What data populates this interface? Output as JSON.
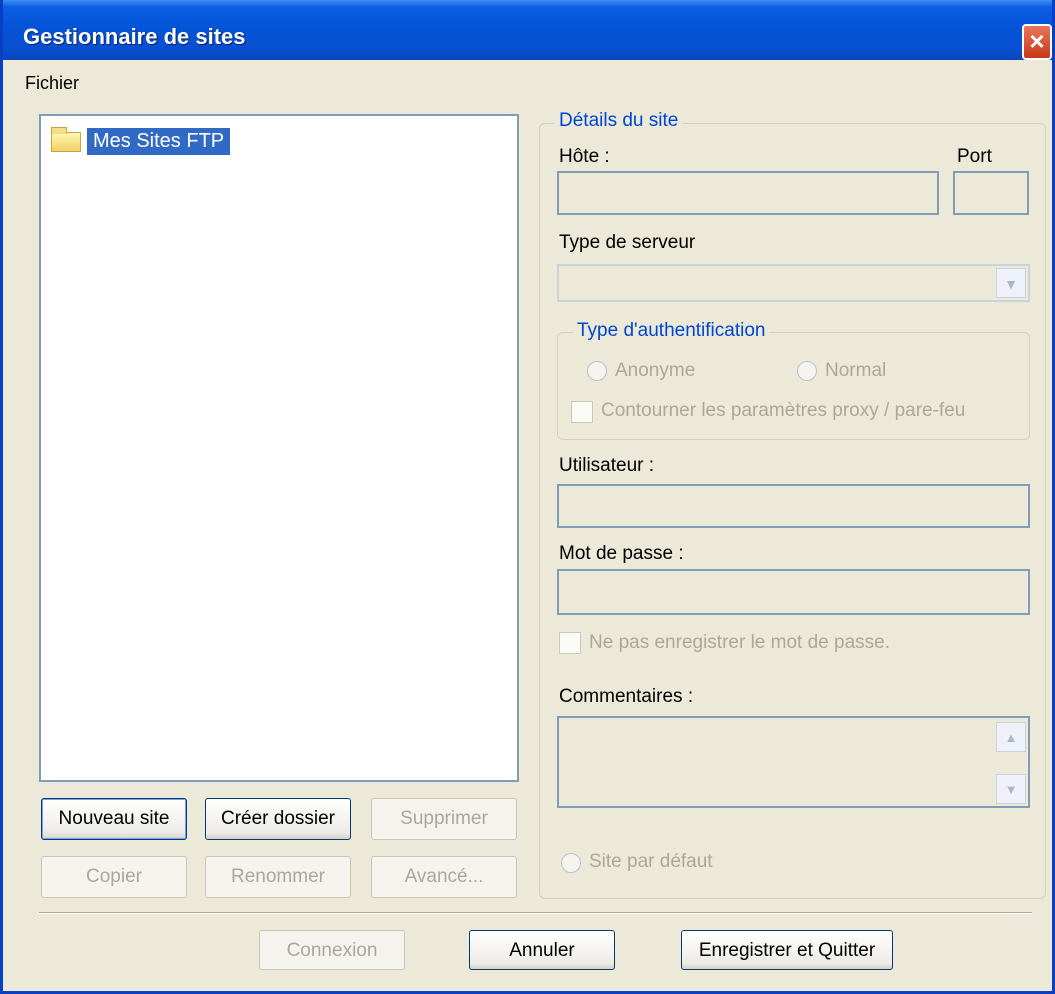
{
  "window": {
    "title": "Gestionnaire de sites",
    "close_icon": "×"
  },
  "menu": {
    "items": [
      {
        "label": "Fichier"
      }
    ]
  },
  "tree": {
    "root_label": "Mes Sites FTP"
  },
  "left_buttons": {
    "new_site": "Nouveau site",
    "new_folder": "Créer dossier",
    "delete": "Supprimer",
    "copy": "Copier",
    "rename": "Renommer",
    "advanced": "Avancé..."
  },
  "details": {
    "legend": "Détails du site",
    "host_label": "Hôte :",
    "host_value": "",
    "port_label": "Port",
    "port_value": "",
    "server_type_label": "Type de serveur",
    "server_type_value": "",
    "auth": {
      "legend": "Type d'authentification",
      "anonymous": "Anonyme",
      "normal": "Normal",
      "bypass_proxy": "Contourner les paramètres proxy / pare-feu"
    },
    "user_label": "Utilisateur :",
    "user_value": "",
    "password_label": "Mot de passe :",
    "password_value": "",
    "dont_save_password": "Ne pas enregistrer le mot de passe.",
    "comments_label": "Commentaires :",
    "comments_value": "",
    "default_site": "Site par défaut"
  },
  "bottom_buttons": {
    "connect": "Connexion",
    "cancel": "Annuler",
    "save_quit": "Enregistrer et Quitter"
  },
  "colors": {
    "title_bar": "#0553d6",
    "selection": "#316ac5",
    "group_legend": "#0046d5",
    "dialog_bg": "#ece9d8"
  }
}
